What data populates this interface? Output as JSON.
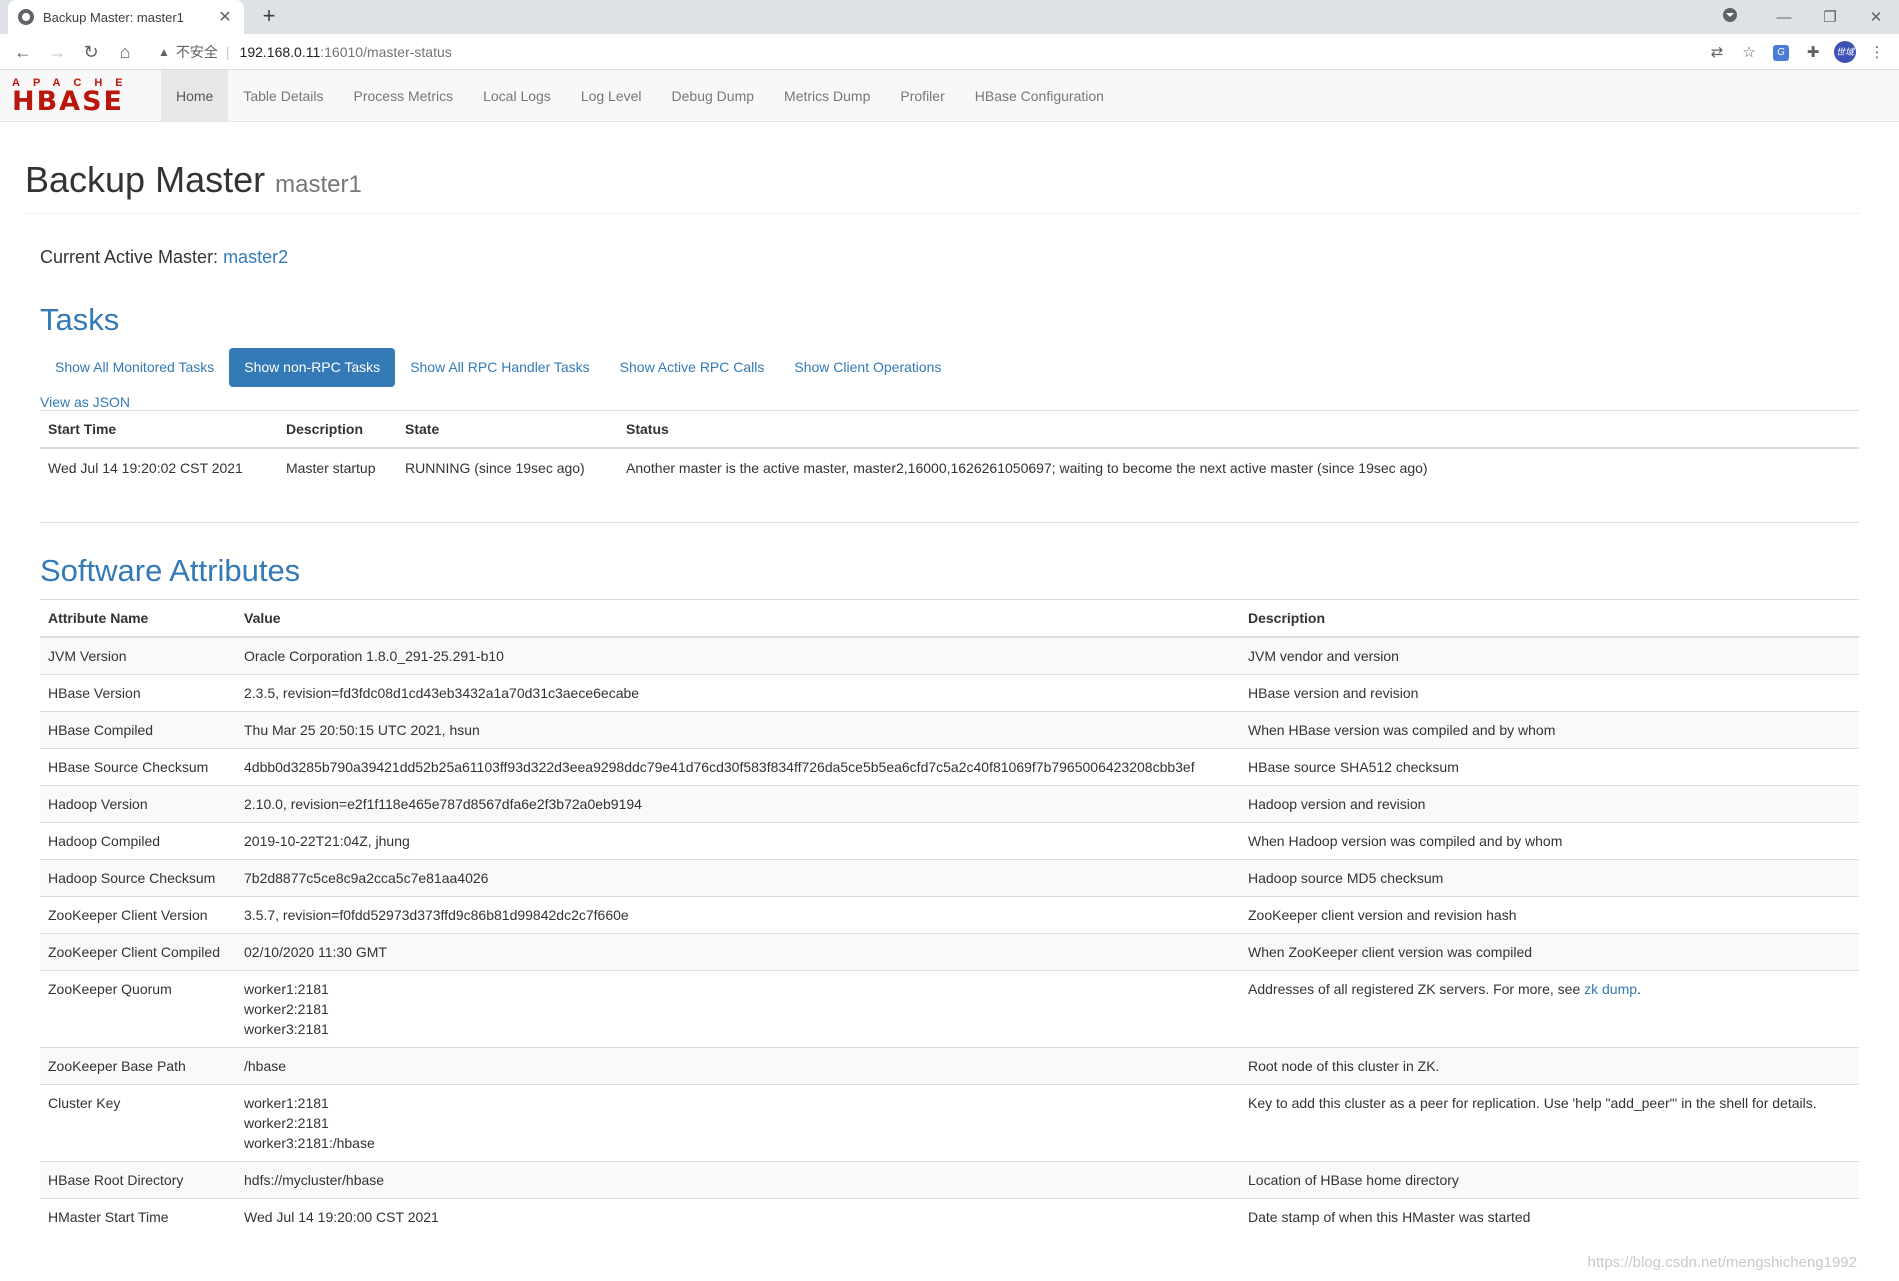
{
  "browser": {
    "tab_title": "Backup Master: master1",
    "new_tab": "+",
    "omnibox": {
      "insecure_label": "不安全",
      "host": "192.168.0.11",
      "path": ":16010/master-status"
    },
    "profile_label": "世域"
  },
  "navbar": {
    "brand_top": "APACHE",
    "brand_main": "HBASE",
    "items": [
      {
        "label": "Home",
        "active": true
      },
      {
        "label": "Table Details"
      },
      {
        "label": "Process Metrics"
      },
      {
        "label": "Local Logs"
      },
      {
        "label": "Log Level"
      },
      {
        "label": "Debug Dump"
      },
      {
        "label": "Metrics Dump"
      },
      {
        "label": "Profiler"
      },
      {
        "label": "HBase Configuration"
      }
    ]
  },
  "header": {
    "title": "Backup Master",
    "subtitle": "master1"
  },
  "active_master": {
    "label": "Current Active Master: ",
    "link": "master2"
  },
  "tasks": {
    "title": "Tasks",
    "pills": [
      {
        "label": "Show All Monitored Tasks"
      },
      {
        "label": "Show non-RPC Tasks",
        "active": true
      },
      {
        "label": "Show All RPC Handler Tasks"
      },
      {
        "label": "Show Active RPC Calls"
      },
      {
        "label": "Show Client Operations"
      }
    ],
    "json_link": "View as JSON",
    "columns": [
      "Start Time",
      "Description",
      "State",
      "Status"
    ],
    "rows": [
      [
        "Wed Jul 14 19:20:02 CST 2021",
        "Master startup",
        "RUNNING (since 19sec ago)",
        "Another master is the active master, master2,16000,1626261050697; waiting to become the next active master (since 19sec ago)"
      ]
    ]
  },
  "software": {
    "title": "Software Attributes",
    "columns": [
      "Attribute Name",
      "Value",
      "Description"
    ],
    "rows": [
      {
        "name": "JVM Version",
        "value": [
          "Oracle Corporation 1.8.0_291-25.291-b10"
        ],
        "desc": "JVM vendor and version"
      },
      {
        "name": "HBase Version",
        "value": [
          "2.3.5, revision=fd3fdc08d1cd43eb3432a1a70d31c3aece6ecabe"
        ],
        "desc": "HBase version and revision"
      },
      {
        "name": "HBase Compiled",
        "value": [
          "Thu Mar 25 20:50:15 UTC 2021, hsun"
        ],
        "desc": "When HBase version was compiled and by whom"
      },
      {
        "name": "HBase Source Checksum",
        "value": [
          "4dbb0d3285b790a39421dd52b25a61103ff93d322d3eea9298ddc79e41d76cd30f583f834ff726da5ce5b5ea6cfd7c5a2c40f81069f7b7965006423208cbb3ef"
        ],
        "desc": "HBase source SHA512 checksum"
      },
      {
        "name": "Hadoop Version",
        "value": [
          "2.10.0, revision=e2f1f118e465e787d8567dfa6e2f3b72a0eb9194"
        ],
        "desc": "Hadoop version and revision"
      },
      {
        "name": "Hadoop Compiled",
        "value": [
          "2019-10-22T21:04Z, jhung"
        ],
        "desc": "When Hadoop version was compiled and by whom"
      },
      {
        "name": "Hadoop Source Checksum",
        "value": [
          "7b2d8877c5ce8c9a2cca5c7e81aa4026"
        ],
        "desc": "Hadoop source MD5 checksum"
      },
      {
        "name": "ZooKeeper Client Version",
        "value": [
          "3.5.7, revision=f0fdd52973d373ffd9c86b81d99842dc2c7f660e"
        ],
        "desc": "ZooKeeper client version and revision hash"
      },
      {
        "name": "ZooKeeper Client Compiled",
        "value": [
          "02/10/2020 11:30 GMT"
        ],
        "desc": "When ZooKeeper client version was compiled"
      },
      {
        "name": "ZooKeeper Quorum",
        "value": [
          "worker1:2181",
          "worker2:2181",
          "worker3:2181"
        ],
        "desc": "Addresses of all registered ZK servers. For more, see ",
        "desc_link": "zk dump",
        "desc_after": "."
      },
      {
        "name": "ZooKeeper Base Path",
        "value": [
          "/hbase"
        ],
        "desc": "Root node of this cluster in ZK."
      },
      {
        "name": "Cluster Key",
        "value": [
          "worker1:2181",
          "worker2:2181",
          "worker3:2181:/hbase"
        ],
        "desc": "Key to add this cluster as a peer for replication. Use 'help \"add_peer\"' in the shell for details."
      },
      {
        "name": "HBase Root Directory",
        "value": [
          "hdfs://mycluster/hbase"
        ],
        "desc": "Location of HBase home directory"
      },
      {
        "name": "HMaster Start Time",
        "value": [
          "Wed Jul 14 19:20:00 CST 2021"
        ],
        "desc": "Date stamp of when this HMaster was started"
      }
    ]
  },
  "watermark": "https://blog.csdn.net/mengshicheng1992"
}
